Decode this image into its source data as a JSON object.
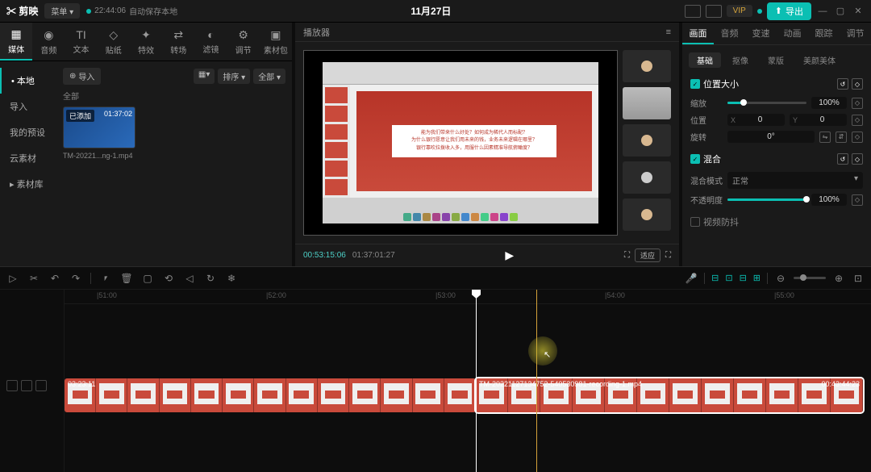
{
  "titlebar": {
    "logo": "✂ 剪映",
    "menu": "菜单 ▾",
    "save_time": "22:44:06",
    "save_text": "自动保存本地",
    "title": "11月27日",
    "vip": "VIP",
    "export": "导出"
  },
  "media_tabs": [
    {
      "icon": "▦",
      "label": "媒体"
    },
    {
      "icon": "◉",
      "label": "音频"
    },
    {
      "icon": "TI",
      "label": "文本"
    },
    {
      "icon": "◇",
      "label": "贴纸"
    },
    {
      "icon": "✦",
      "label": "特效"
    },
    {
      "icon": "⇄",
      "label": "转场"
    },
    {
      "icon": "◐",
      "label": "滤镜"
    },
    {
      "icon": "⚙",
      "label": "调节"
    },
    {
      "icon": "▣",
      "label": "素材包"
    }
  ],
  "media_sidebar": [
    {
      "label": "• 本地",
      "active": true
    },
    {
      "label": "导入"
    },
    {
      "label": "我的预设"
    },
    {
      "label": "云素材"
    },
    {
      "label": "▸ 素材库"
    }
  ],
  "media_toolbar": {
    "import": "导入",
    "sort": "排序 ▾",
    "all": "全部 ▾",
    "section": "全部"
  },
  "media_thumb": {
    "badge": "已添加",
    "duration": "01:37:02",
    "name": "TM-20221...ng-1.mp4"
  },
  "player": {
    "header": "播放器",
    "slide_line1": "能为我们带来什么好处？如何成为稀代人而标配？",
    "slide_line2": "为什么银行愿意让我们用未来的钱，业务未来逻辑在哪里？",
    "slide_line3": "银行靠吹拉拨收入多，用服什么因素精准导航俯瞰度？",
    "tc_current": "00:53:15:06",
    "tc_total": "01:37:01:27",
    "ratio": "适应"
  },
  "props_tabs": [
    "画面",
    "音频",
    "变速",
    "动画",
    "跟踪",
    "调节"
  ],
  "props_subtabs": [
    "基础",
    "抠像",
    "蒙版",
    "美颜美体"
  ],
  "props": {
    "section_position": "位置大小",
    "scale_label": "缩放",
    "scale_value": "100%",
    "pos_label": "位置",
    "pos_x": "0",
    "pos_y": "0",
    "rotate_label": "旋转",
    "rotate_value": "0°",
    "section_blend": "混合",
    "blend_mode_label": "混合模式",
    "blend_mode_value": "正常",
    "opacity_label": "不透明度",
    "opacity_value": "100%",
    "section_mask": "视频防抖"
  },
  "timeline": {
    "ruler_ticks": [
      "|51:00",
      "|52:00",
      "|53:00",
      "|54:00",
      "|55:00"
    ],
    "clip1_label": "03:23:11",
    "clip2_label": "TM-20221127134752-540530981-recording-1.mp4",
    "clip2_dur": "00:43:44:23"
  }
}
